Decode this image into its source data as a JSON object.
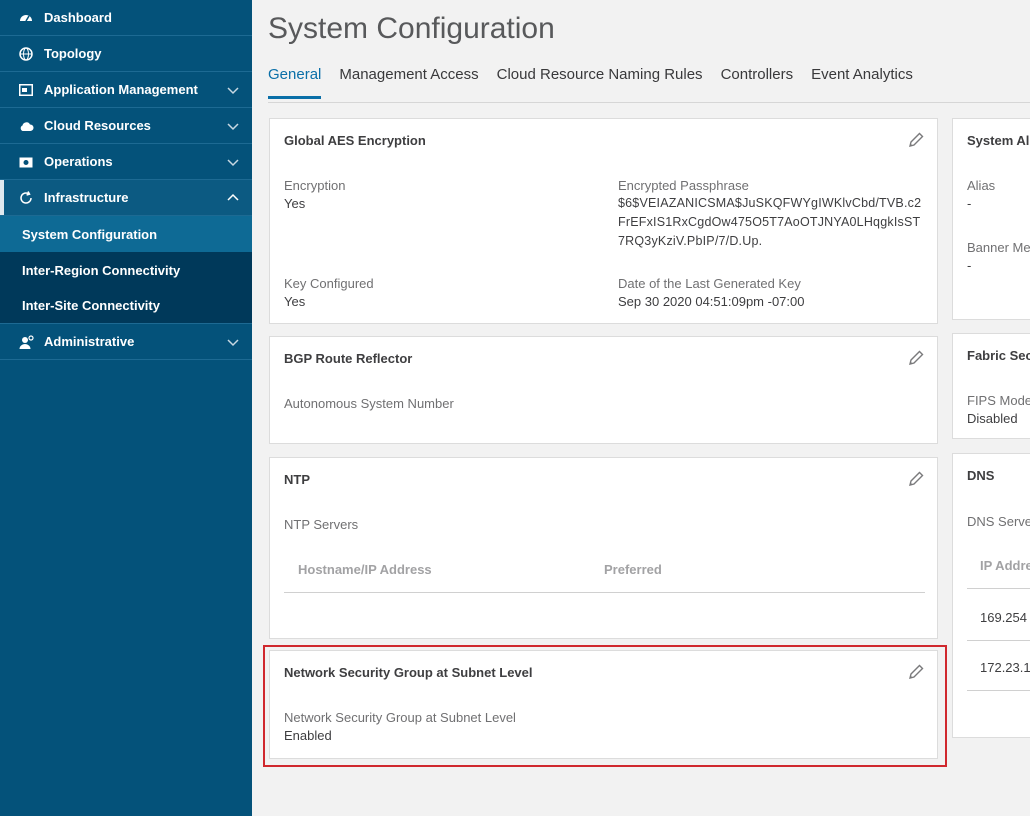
{
  "sidebar": {
    "items": [
      {
        "label": "Dashboard"
      },
      {
        "label": "Topology"
      },
      {
        "label": "Application Management"
      },
      {
        "label": "Cloud Resources"
      },
      {
        "label": "Operations"
      },
      {
        "label": "Infrastructure"
      },
      {
        "label": "Administrative"
      }
    ],
    "sub_items": [
      {
        "label": "System Configuration"
      },
      {
        "label": "Inter-Region Connectivity"
      },
      {
        "label": "Inter-Site Connectivity"
      }
    ]
  },
  "main": {
    "title": "System Configuration",
    "tabs": [
      {
        "label": "General"
      },
      {
        "label": "Management Access"
      },
      {
        "label": "Cloud Resource Naming Rules"
      },
      {
        "label": "Controllers"
      },
      {
        "label": "Event Analytics"
      }
    ]
  },
  "aes": {
    "title": "Global AES Encryption",
    "encryption_label": "Encryption",
    "encryption_value": "Yes",
    "passphrase_label": "Encrypted Passphrase",
    "passphrase_line1": "$6$VEIAZANICSMA$JuSKQFWYgIWKlvCbd/TVB.c2",
    "passphrase_line2": "FrEFxIS1RxCgdOw475O5T7AoOTJNYA0LHqgkIsST",
    "passphrase_line3": "7RQ3yKziV.PbIP/7/D.Up.",
    "key_configured_label": "Key Configured",
    "key_configured_value": "Yes",
    "last_key_label": "Date of the Last Generated Key",
    "last_key_value": "Sep 30 2020 04:51:09pm -07:00"
  },
  "bgp": {
    "title": "BGP Route Reflector",
    "asn_label": "Autonomous System Number"
  },
  "ntp": {
    "title": "NTP",
    "servers_label": "NTP Servers",
    "col_host": "Hostname/IP Address",
    "col_pref": "Preferred"
  },
  "nsg": {
    "title": "Network Security Group at Subnet Level",
    "label": "Network Security Group at Subnet Level",
    "value": "Enabled"
  },
  "sys_alias": {
    "title": "System Ali",
    "alias_label": "Alias",
    "alias_value": "-",
    "banner_label": "Banner Me",
    "banner_value": "-"
  },
  "fabric": {
    "title": "Fabric Sec",
    "fips_label": "FIPS Mode",
    "fips_value": "Disabled"
  },
  "dns": {
    "title": "DNS",
    "servers_label": "DNS Serve",
    "col_ip": "IP Addre",
    "rows": [
      "169.254",
      "172.23.1"
    ]
  },
  "colors": {
    "sidebar_bg": "#04527a",
    "accent": "#0a6fa8",
    "highlight": "#d0282e"
  }
}
